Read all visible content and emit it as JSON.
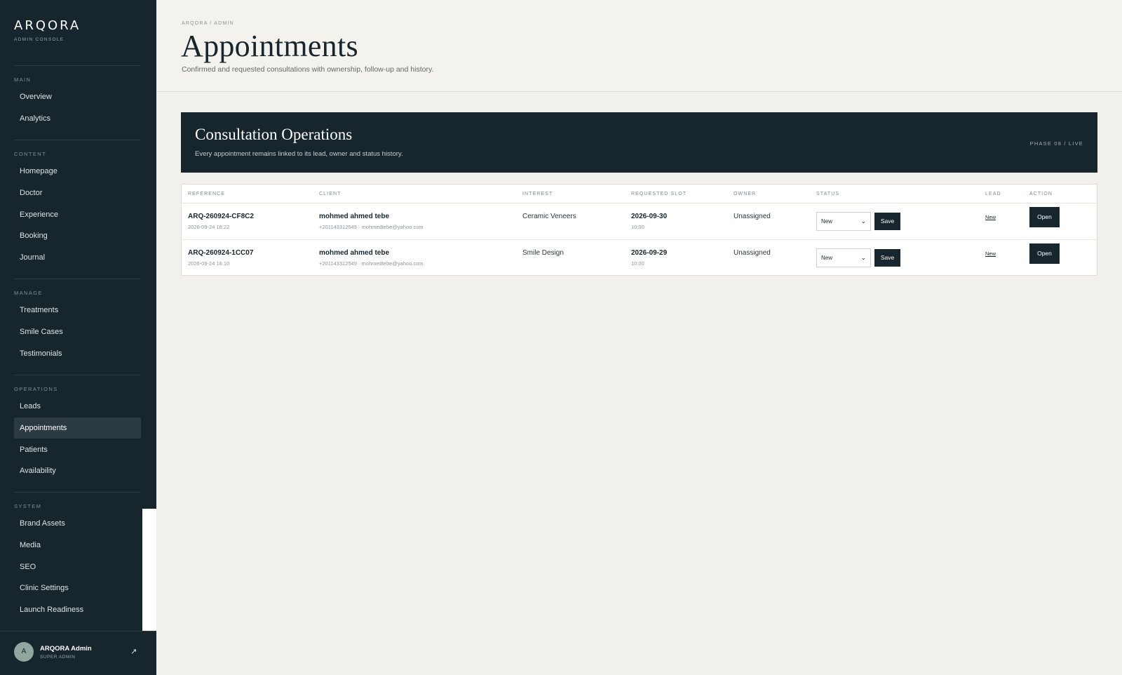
{
  "brand": {
    "name": "ARQORA",
    "subtitle": "ADMIN CONSOLE"
  },
  "sidebar": {
    "sections": [
      {
        "title": "MAIN",
        "items": [
          "Overview",
          "Analytics"
        ]
      },
      {
        "title": "CONTENT",
        "items": [
          "Homepage",
          "Doctor",
          "Experience",
          "Booking",
          "Journal"
        ]
      },
      {
        "title": "MANAGE",
        "items": [
          "Treatments",
          "Smile Cases",
          "Testimonials"
        ]
      },
      {
        "title": "OPERATIONS",
        "items": [
          "Leads",
          "Appointments",
          "Patients",
          "Availability"
        ]
      },
      {
        "title": "SYSTEM",
        "items": [
          "Brand Assets",
          "Media",
          "SEO",
          "Clinic Settings",
          "Launch Readiness"
        ]
      }
    ],
    "active_item": "Appointments"
  },
  "user": {
    "initial": "A",
    "name": "ARQORA Admin",
    "role": "SUPER ADMIN",
    "logout_icon": "arrow-up-right-icon"
  },
  "header": {
    "breadcrumb": "ARQORA / ADMIN",
    "title": "Appointments",
    "subtitle": "Confirmed and requested consultations with ownership, follow-up and history."
  },
  "banner": {
    "title": "Consultation Operations",
    "subtitle": "Every appointment remains linked to its lead, owner and status history.",
    "tag": "PHASE 08 / LIVE"
  },
  "table": {
    "columns": [
      "REFERENCE",
      "CLIENT",
      "INTEREST",
      "REQUESTED SLOT",
      "OWNER",
      "STATUS",
      "LEAD",
      "ACTION"
    ],
    "rows": [
      {
        "reference": "ARQ-260924-CF8C2",
        "created": "2026-09-24 16:22",
        "client_name": "mohmed ahmed tebe",
        "client_contact": "+201143312549 · mohmedtebe@yahoo.com",
        "interest": "Ceramic Veneers",
        "slot_date": "2026-09-30",
        "slot_time": "10:00",
        "owner": "Unassigned",
        "status": "New",
        "save_label": "Save",
        "lead": "New",
        "action_label": "Open"
      },
      {
        "reference": "ARQ-260924-1CC07",
        "created": "2026-09-24 16:10",
        "client_name": "mohmed ahmed tebe",
        "client_contact": "+201143312549 · mohmedtebe@yahoo.com",
        "interest": "Smile Design",
        "slot_date": "2026-09-29",
        "slot_time": "10:00",
        "owner": "Unassigned",
        "status": "New",
        "save_label": "Save",
        "lead": "New",
        "action_label": "Open"
      }
    ]
  },
  "colors": {
    "sidebar_bg": "#17262d",
    "page_bg": "#f2f0eb",
    "accent": "#17262d"
  }
}
